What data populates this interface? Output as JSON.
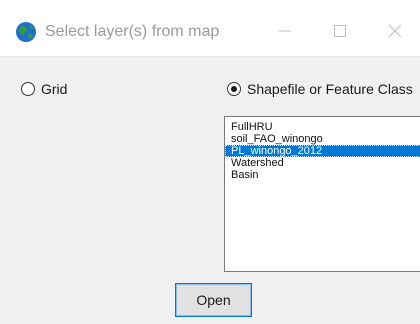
{
  "window": {
    "title": "Select layer(s) from map",
    "icon": "globe-icon",
    "controls": [
      "minimize-icon",
      "maximize-icon",
      "close-icon"
    ]
  },
  "options": {
    "grid_label": "Grid",
    "grid_selected": false,
    "shapefile_label": "Shapefile or Feature Class",
    "shapefile_selected": true
  },
  "layers": {
    "items": [
      "FullHRU",
      "soil_FAO_winongo",
      "PL_winongo_2012",
      "Watershed",
      "Basin"
    ],
    "selected": "PL_winongo_2012"
  },
  "actions": {
    "open_label": "Open"
  },
  "colors": {
    "selection": "#0078d7",
    "button_border": "#0078d7",
    "window_bg": "#f0f0f0"
  }
}
